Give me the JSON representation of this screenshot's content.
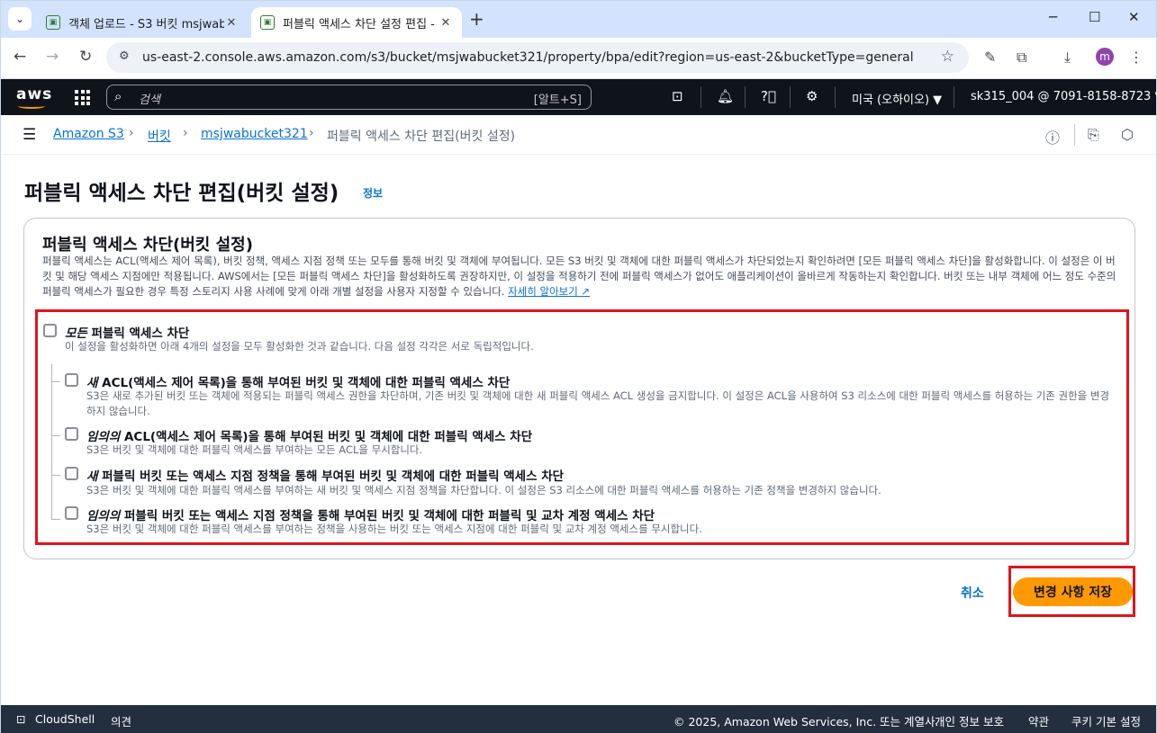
{
  "browser": {
    "tabs": [
      {
        "title": "객체 업로드 - S3 버킷 msjwabucket321",
        "close": "✕"
      },
      {
        "title": "퍼블릭 액세스 차단 설정 편집 - S3",
        "close": "✕"
      }
    ],
    "new_tab": "+",
    "url": "us-east-2.console.aws.amazon.com/s3/bucket/msjwabucket321/property/bpa/edit?region=us-east-2&bucketType=general",
    "profile_initial": "m"
  },
  "aws_header": {
    "logo": "aws",
    "search_placeholder": "검색",
    "search_shortcut": "[알트+S]",
    "region": "미국 (오하이오) ▼",
    "account": "sk315_004 @ 7091-8158-8723 ▼"
  },
  "breadcrumbs": [
    "Amazon S3",
    "버킷",
    "msjwabucket321",
    "퍼블릭 액세스 차단 편집(버킷 설정)"
  ],
  "page": {
    "title": "퍼블릭 액세스 차단 편집(버킷 설정)",
    "info_link": "정보",
    "section_title": "퍼블릭 액세스 차단(버킷 설정)",
    "description": "퍼블릭 액세스는 ACL(액세스 제어 목록), 버킷 정책, 액세스 지점 정책 또는 모두를 통해 버킷 및 객체에 부여됩니다. 모든 S3 버킷 및 객체에 대한 퍼블릭 액세스가 차단되었는지 확인하려면 [모든 퍼블릭 액세스 차단]을 활성화합니다. 이 설정은 이 버킷 및 해당 액세스 지점에만 적용됩니다. AWS에서는 [모든 퍼블릭 액세스 차단]을 활성화하도록 권장하지만, 이 설정을 적용하기 전에 퍼블릭 액세스가 없어도 애플리케이션이 올바르게 작동하는지 확인합니다. 버킷 또는 내부 객체에 어느 정도 수준의 퍼블릭 액세스가 필요한 경우 특정 스토리지 사용 사례에 맞게 아래 개별 설정을 사용자 지정할 수 있습니다.",
    "learn_more": "자세히 알아보기",
    "block_all": {
      "label_em": "모든",
      "label_rest": " 퍼블릭 액세스 차단",
      "help": "이 설정을 활성화하면 아래 4개의 설정을 모두 활성화한 것과 같습니다. 다음 설정 각각은 서로 독립적입니다.",
      "checked": false
    },
    "options": [
      {
        "label_em": "새",
        "label_rest": " ACL(액세스 제어 목록)을 통해 부여된 버킷 및 객체에 대한 퍼블릭 액세스 차단",
        "help": "S3은 새로 추가된 버킷 또는 객체에 적용되는 퍼블릭 액세스 권한을 차단하며, 기존 버킷 및 객체에 대한 새 퍼블릭 액세스 ACL 생성을 금지합니다. 이 설정은 ACL을 사용하여 S3 리소스에 대한 퍼블릭 액세스를 허용하는 기존 권한을 변경하지 않습니다.",
        "checked": false
      },
      {
        "label_em": "임의의",
        "label_rest": " ACL(액세스 제어 목록)을 통해 부여된 버킷 및 객체에 대한 퍼블릭 액세스 차단",
        "help": "S3은 버킷 및 객체에 대한 퍼블릭 액세스를 부여하는 모든 ACL을 무시합니다.",
        "checked": false
      },
      {
        "label_em": "새",
        "label_rest": " 퍼블릭 버킷 또는 액세스 지점 정책을 통해 부여된 버킷 및 객체에 대한 퍼블릭 액세스 차단",
        "help": "S3은 버킷 및 객체에 대한 퍼블릭 액세스를 부여하는 새 버킷 및 액세스 지점 정책을 차단합니다. 이 설정은 S3 리소스에 대한 퍼블릭 액세스를 허용하는 기존 정책을 변경하지 않습니다.",
        "checked": false
      },
      {
        "label_em": "임의의",
        "label_rest": " 퍼블릭 버킷 또는 액세스 지점 정책을 통해 부여된 버킷 및 객체에 대한 퍼블릭 및 교차 계정 액세스 차단",
        "help": "S3은 버킷 및 객체에 대한 퍼블릭 액세스를 부여하는 정책을 사용하는 버킷 또는 액세스 지점에 대한 퍼블릭 및 교차 계정 액세스를 무시합니다.",
        "checked": false
      }
    ],
    "cancel_label": "취소",
    "save_label": "변경 사항 저장"
  },
  "footer": {
    "cloudshell": "CloudShell",
    "feedback": "의견",
    "copyright": "© 2025, Amazon Web Services, Inc. 또는 계열사.",
    "privacy": "개인 정보 보호",
    "terms": "약관",
    "cookies": "쿠키 기본 설정"
  },
  "colors": {
    "aws_nav": "#0f141a",
    "footer": "#232f3e",
    "primary_button": "#ff9900",
    "link": "#0972d3",
    "highlight_box": "#e0141e"
  }
}
